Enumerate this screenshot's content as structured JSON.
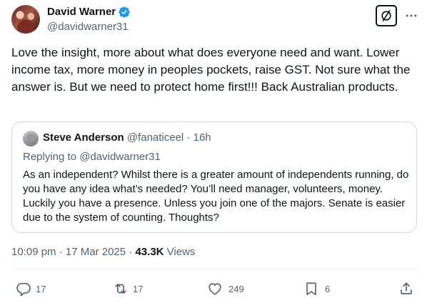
{
  "author": {
    "display_name": "David Warner",
    "handle": "@davidwarner31",
    "verified": true
  },
  "tweet": {
    "text": "Love the insight, more about what does everyone need and want. Lower income tax, more money in peoples pockets, raise GST. Not sure what the answer is. But we need to protect home first!!! Back Australian products.",
    "time": "10:09 pm",
    "separator": "·",
    "date": "17 Mar 2025",
    "views_count": "43.3K",
    "views_label": "Views"
  },
  "quote": {
    "display_name": "Steve Anderson",
    "handle": "@fanaticeel",
    "separator": "·",
    "time": "16h",
    "replying_to_label": "Replying to @davidwarner31",
    "text": "As an independent? Whilst there is a greater amount of independents running, do you have any idea what’s needed? You’ll need manager, volunteers, money. Luckily you have a presence. Unless you join one of the majors. Senate is easier due to the system of counting. Thoughts?"
  },
  "actions": {
    "replies": "17",
    "reposts": "17",
    "likes": "249",
    "bookmarks": "6"
  },
  "icons": {
    "verified": "verified-badge-icon",
    "grok": "grok-icon",
    "more": "more-dots-icon",
    "reply": "reply-icon",
    "repost": "repost-icon",
    "like": "heart-icon",
    "bookmark": "bookmark-icon",
    "share": "share-icon"
  },
  "colors": {
    "text_primary": "#0f1419",
    "text_secondary": "#536471",
    "verified_blue": "#1d9bf0",
    "border": "#cfd9de"
  }
}
